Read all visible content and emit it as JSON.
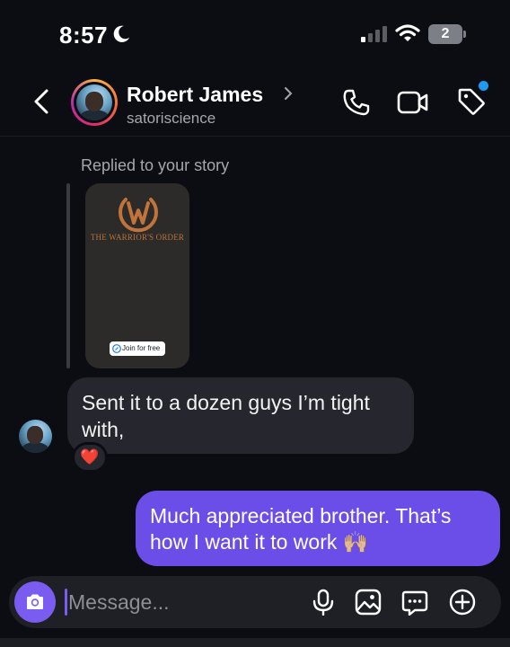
{
  "status_bar": {
    "time": "8:57",
    "battery_text": "2"
  },
  "header": {
    "contact_name": "Robert James",
    "username": "satoriscience"
  },
  "story_reply": {
    "caption": "Replied to your story",
    "story_title": "THE WARRIOR'S ORDER",
    "chip_label": "Join for free"
  },
  "messages": [
    {
      "direction": "incoming",
      "text": "Sent it to a dozen guys I’m tight with,",
      "reaction": "❤️"
    },
    {
      "direction": "outgoing",
      "text": "Much appreciated brother. That’s how I want it to work 🙌🏼"
    }
  ],
  "composer": {
    "placeholder": "Message..."
  },
  "colors": {
    "background": "#0c0d12",
    "incoming_bubble": "#26272e",
    "outgoing_bubble": "#6b4ee8",
    "accent": "#7a5df0",
    "notification_dot": "#1d9bf0"
  },
  "icons": {
    "status": [
      "moon-icon",
      "signal-icon",
      "wifi-icon",
      "battery-icon"
    ],
    "header": [
      "back-chevron-icon",
      "chevron-right-icon",
      "phone-icon",
      "video-camera-icon",
      "tag-icon"
    ],
    "composer": [
      "camera-icon",
      "microphone-icon",
      "gallery-icon",
      "sticker-icon",
      "plus-circle-icon"
    ]
  }
}
